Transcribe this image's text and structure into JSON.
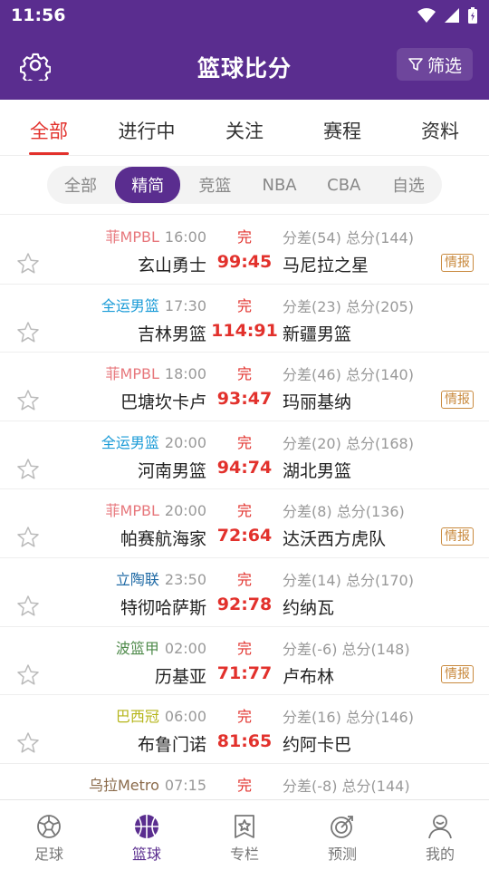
{
  "status_bar": {
    "time": "11:56"
  },
  "header": {
    "title": "篮球比分",
    "filter_label": "筛选"
  },
  "tabs": [
    {
      "label": "全部",
      "active": true
    },
    {
      "label": "进行中",
      "active": false
    },
    {
      "label": "关注",
      "active": false
    },
    {
      "label": "赛程",
      "active": false
    },
    {
      "label": "资料",
      "active": false
    }
  ],
  "subtabs": [
    {
      "label": "全部",
      "active": false
    },
    {
      "label": "精简",
      "active": true
    },
    {
      "label": "竞篮",
      "active": false
    },
    {
      "label": "NBA",
      "active": false
    },
    {
      "label": "CBA",
      "active": false
    },
    {
      "label": "自选",
      "active": false
    }
  ],
  "matches": [
    {
      "league": "菲MPBL",
      "league_color": "#e7777c",
      "time": "16:00",
      "status": "完",
      "spread": "分差(54)",
      "total": "总分(144)",
      "home": "玄山勇士",
      "score": "99:45",
      "away": "马尼拉之星",
      "intel": "情报"
    },
    {
      "league": "全运男篮",
      "league_color": "#1a9bd7",
      "time": "17:30",
      "status": "完",
      "spread": "分差(23)",
      "total": "总分(205)",
      "home": "吉林男篮",
      "score": "114:91",
      "away": "新疆男篮",
      "intel": ""
    },
    {
      "league": "菲MPBL",
      "league_color": "#e7777c",
      "time": "18:00",
      "status": "完",
      "spread": "分差(46)",
      "total": "总分(140)",
      "home": "巴塘坎卡卢",
      "score": "93:47",
      "away": "玛丽基纳",
      "intel": "情报"
    },
    {
      "league": "全运男篮",
      "league_color": "#1a9bd7",
      "time": "20:00",
      "status": "完",
      "spread": "分差(20)",
      "total": "总分(168)",
      "home": "河南男篮",
      "score": "94:74",
      "away": "湖北男篮",
      "intel": ""
    },
    {
      "league": "菲MPBL",
      "league_color": "#e7777c",
      "time": "20:00",
      "status": "完",
      "spread": "分差(8)",
      "total": "总分(136)",
      "home": "帕赛航海家",
      "score": "72:64",
      "away": "达沃西方虎队",
      "intel": "情报"
    },
    {
      "league": "立陶联",
      "league_color": "#1f6aa5",
      "time": "23:50",
      "status": "完",
      "spread": "分差(14)",
      "total": "总分(170)",
      "home": "特彻哈萨斯",
      "score": "92:78",
      "away": "约纳瓦",
      "intel": ""
    },
    {
      "league": "波篮甲",
      "league_color": "#4e8a4a",
      "time": "02:00",
      "status": "完",
      "spread": "分差(-6)",
      "total": "总分(148)",
      "home": "历基亚",
      "score": "71:77",
      "away": "卢布林",
      "intel": "情报"
    },
    {
      "league": "巴西冠",
      "league_color": "#b5b51a",
      "time": "06:00",
      "status": "完",
      "spread": "分差(16)",
      "total": "总分(146)",
      "home": "布鲁门诺",
      "score": "81:65",
      "away": "约阿卡巴",
      "intel": ""
    },
    {
      "league": "乌拉Metro",
      "league_color": "#8a6a4a",
      "time": "07:15",
      "status": "完",
      "spread": "分差(-8)",
      "total": "总分(144)",
      "home": "",
      "score": "",
      "away": "",
      "intel": ""
    }
  ],
  "bottom_nav": [
    {
      "label": "足球",
      "icon": "soccer-ball-icon",
      "active": false
    },
    {
      "label": "篮球",
      "icon": "basketball-icon",
      "active": true
    },
    {
      "label": "专栏",
      "icon": "column-star-icon",
      "active": false
    },
    {
      "label": "预测",
      "icon": "target-icon",
      "active": false
    },
    {
      "label": "我的",
      "icon": "profile-icon",
      "active": false
    }
  ],
  "colors": {
    "brand": "#5a2d8f",
    "accent": "#e2312c",
    "intel": "#c98a3e"
  }
}
